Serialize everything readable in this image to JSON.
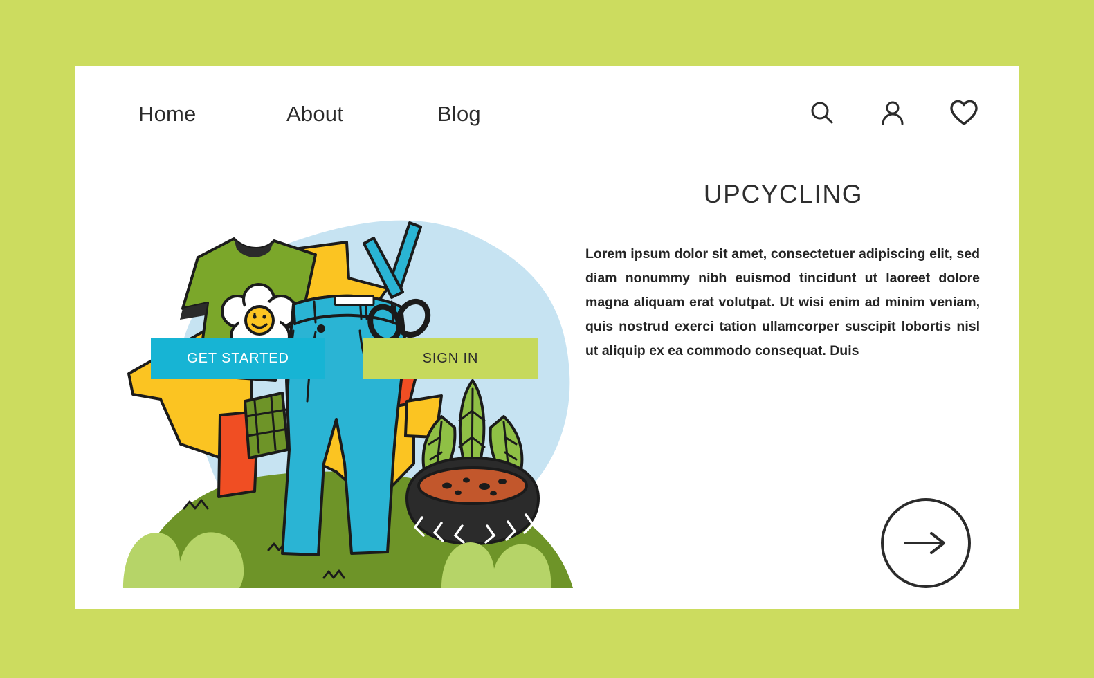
{
  "theme": {
    "page_background": "#ccdc5f",
    "card_background": "#ffffff",
    "accent_cyan": "#17b4d4",
    "accent_green": "#c6d95c",
    "text_dark": "#2b2b2b",
    "blob_blue": "#c6e3f2",
    "hill_green": "#6e9428",
    "grass_green": "#b6d468",
    "shirt_green": "#7ba72a",
    "jeans_blue": "#2ab4d4",
    "arrow_yellow": "#fbc422",
    "arrow_orange": "#f04e23",
    "tire_black": "#2b2b2b",
    "soil_brown": "#c2572c",
    "leaf_green": "#8fc045"
  },
  "nav": {
    "links": [
      {
        "label": "Home",
        "name": "nav-link-home"
      },
      {
        "label": "About",
        "name": "nav-link-about"
      },
      {
        "label": "Blog",
        "name": "nav-link-blog"
      }
    ],
    "icons": [
      {
        "name": "search-icon",
        "label": "Search"
      },
      {
        "name": "user-icon",
        "label": "Account"
      },
      {
        "name": "heart-icon",
        "label": "Favorites"
      }
    ]
  },
  "hero": {
    "headline": "UPCYCLING",
    "paragraph": "Lorem ipsum dolor sit amet, consectetuer adipiscing elit, sed diam nonummy nibh euismod tincidunt ut laoreet dolore magna aliquam erat volutpat. Ut wisi enim ad minim veniam, quis nostrud exerci tation ullamcorper suscipit lobortis nisl ut aliquip ex ea commodo consequat. Duis",
    "primary_button": "GET STARTED",
    "secondary_button": "SIGN IN",
    "next_button_icon": "arrow-right-icon"
  },
  "illustration": {
    "name": "upcycling-illustration",
    "elements": [
      "recycling-arrows",
      "green-t-shirt-with-daisy",
      "blue-jeans-with-patch",
      "cyan-scissors",
      "tire-planter-with-plant",
      "green-hill",
      "grass-tufts"
    ]
  }
}
